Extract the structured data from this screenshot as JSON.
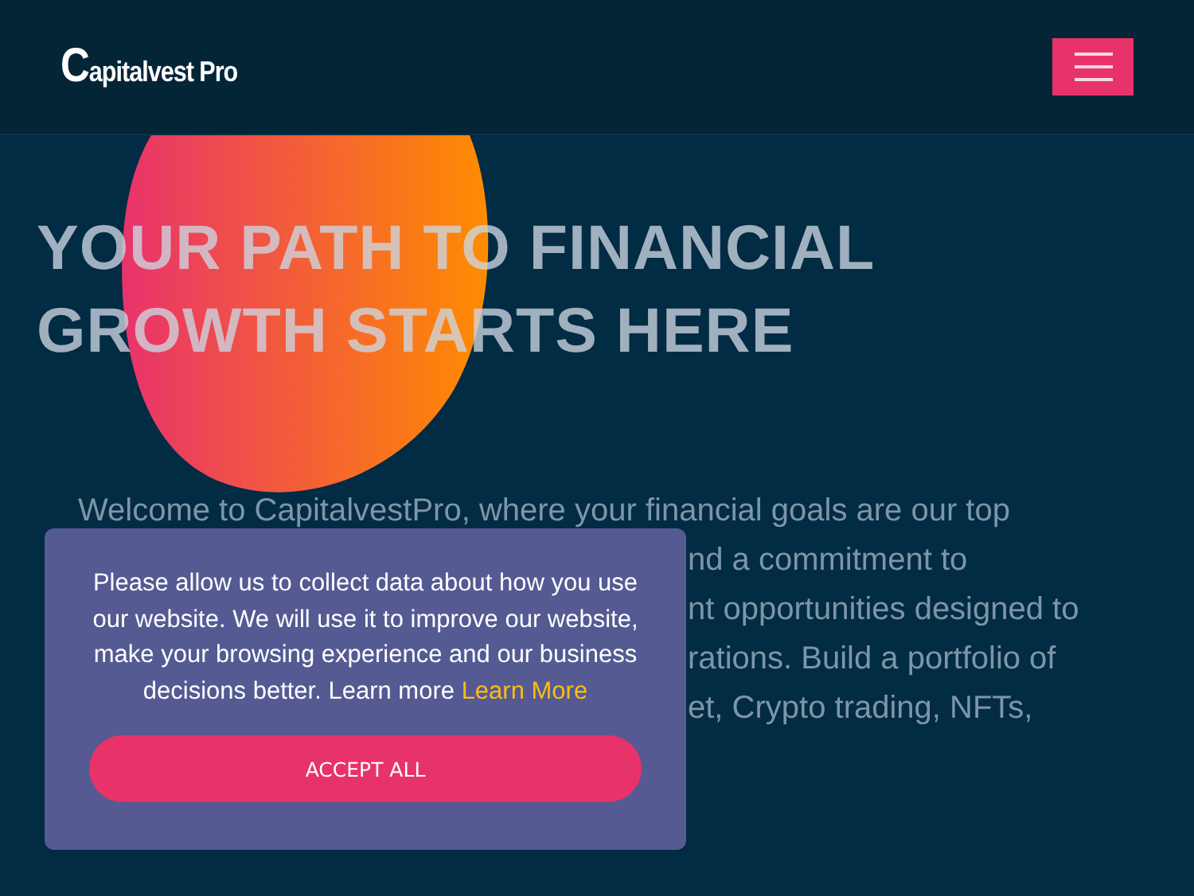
{
  "header": {
    "logo": "Capitalvest Pro"
  },
  "hero": {
    "headline": "YOUR PATH TO FINANCIAL GROWTH STARTS HERE",
    "intro_lines": [
      "Welcome to CapitalvestPro, where your financial goals are our top",
      "nd a commitment to",
      "nt opportunities designed to",
      "rations. Build a portfolio of",
      "et, Crypto trading, NFTs,"
    ]
  },
  "cookie_banner": {
    "message": "Please allow us to collect data about how you use our website. We will use it to improve our website, make your browsing experience and our business decisions better. Learn more",
    "link": "Learn More",
    "button": "ACCEPT ALL"
  }
}
